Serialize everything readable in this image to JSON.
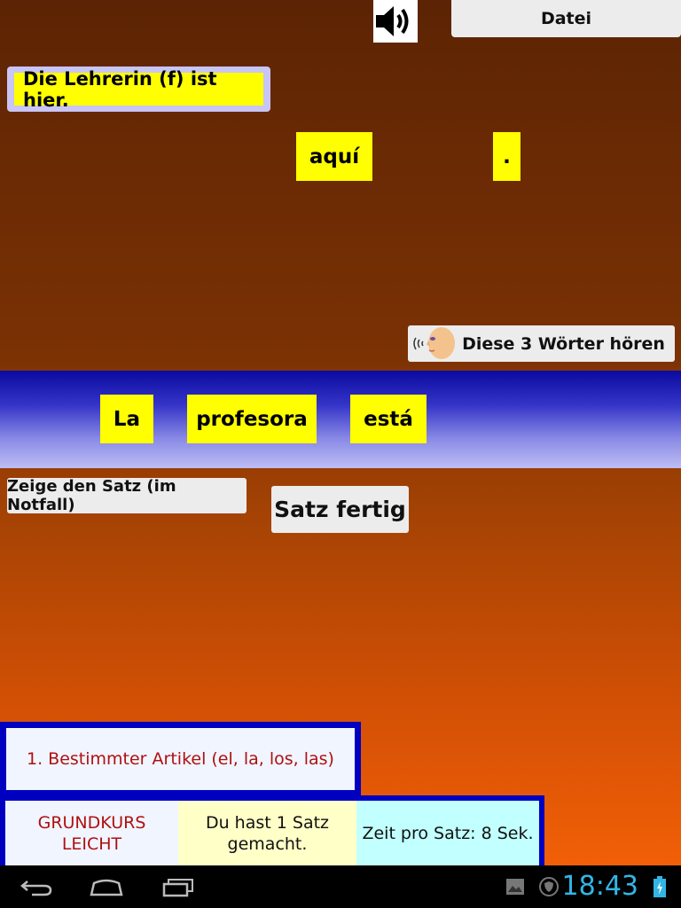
{
  "header": {
    "sound_icon": "speaker-icon",
    "menu_button": "Datei"
  },
  "exercise": {
    "target_sentence": "Die Lehrerin (f) ist hier.",
    "remaining_words": [
      "aquí",
      "."
    ],
    "hear_button": "Diese 3 Wörter hören",
    "hear_icon": "speaking-head-icon"
  },
  "answer": {
    "placed_words": [
      "La",
      "profesora",
      "está"
    ]
  },
  "actions": {
    "show_sentence": "Zeige den Satz (im Notfall)",
    "sentence_done": "Satz fertig"
  },
  "footer": {
    "lesson": "1. Bestimmter Artikel (el, la, los, las)",
    "level_line1": "GRUNDKURS",
    "level_line2": "LEICHT",
    "progress_line1": "Du hast 1 Satz",
    "progress_line2": "gemacht.",
    "time_per_sentence": "Zeit pro Satz: 8 Sek."
  },
  "system_bar": {
    "clock": "18:43",
    "icons": [
      "back-icon",
      "home-icon",
      "recent-apps-icon",
      "gallery-icon",
      "shield-icon",
      "battery-icon"
    ]
  },
  "colors": {
    "tile": "#ffff00",
    "band_top": "#0a0aa0",
    "frame_blue": "#0000c0",
    "lesson_text": "#b01010",
    "clock": "#33b5e5"
  }
}
